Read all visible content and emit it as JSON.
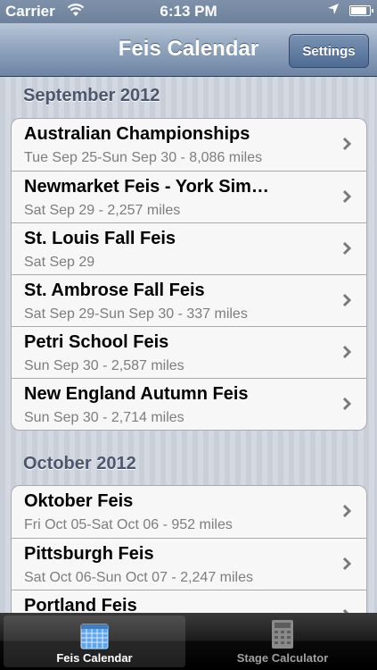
{
  "status": {
    "carrier": "Carrier",
    "time": "6:13 PM"
  },
  "navbar": {
    "title": "Feis Calendar",
    "settings_label": "Settings"
  },
  "sections": [
    {
      "title": "September 2012",
      "events": [
        {
          "name": "Australian Championships",
          "detail": "Tue Sep 25-Sun Sep 30 - 8,086 miles"
        },
        {
          "name": "Newmarket Feis - York Sim…",
          "detail": "Sat Sep 29 - 2,257 miles"
        },
        {
          "name": "St. Louis Fall Feis",
          "detail": "Sat Sep 29"
        },
        {
          "name": "St. Ambrose Fall Feis",
          "detail": "Sat Sep 29-Sun Sep 30 - 337 miles"
        },
        {
          "name": "Petri School Feis",
          "detail": "Sun Sep 30 - 2,587 miles"
        },
        {
          "name": "New England Autumn Feis",
          "detail": "Sun Sep 30 - 2,714 miles"
        }
      ]
    },
    {
      "title": "October 2012",
      "events": [
        {
          "name": "Oktober Feis",
          "detail": "Fri Oct 05-Sat Oct 06 - 952 miles"
        },
        {
          "name": "Pittsburgh Feis",
          "detail": "Sat Oct 06-Sun Oct 07 - 2,247 miles"
        },
        {
          "name": "Portland Feis",
          "detail": ""
        }
      ]
    }
  ],
  "tabs": [
    {
      "label": "Feis Calendar",
      "icon": "calendar-icon",
      "active": true
    },
    {
      "label": "Stage Calculator",
      "icon": "calculator-icon",
      "active": false
    }
  ],
  "icons": {
    "status": [
      "wifi-icon",
      "location-arrow-icon",
      "battery-icon"
    ],
    "row": "chevron-right-icon"
  }
}
